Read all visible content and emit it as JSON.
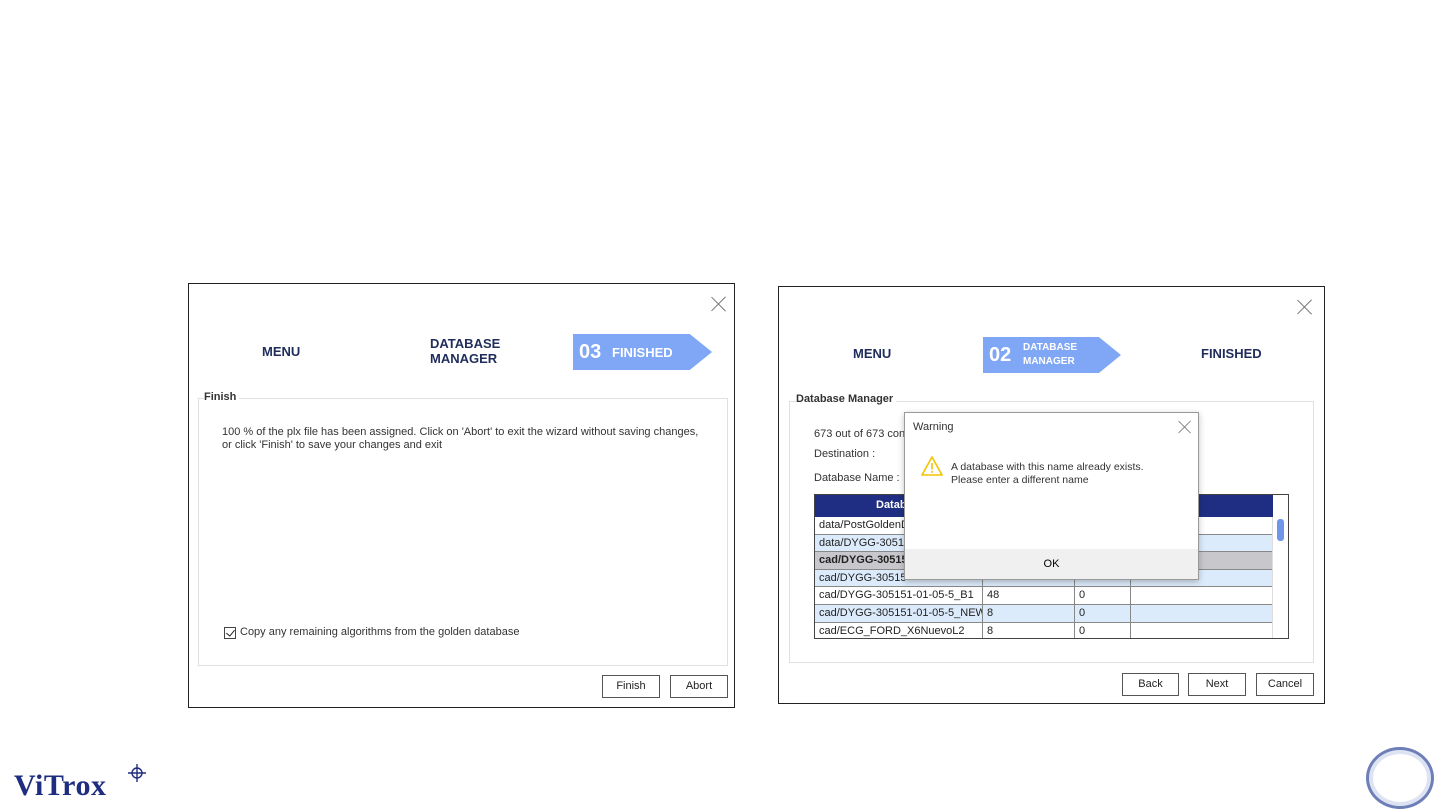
{
  "window1": {
    "steps": {
      "menu": "MENU",
      "database_manager_line1": "DATABASE",
      "database_manager_line2": "MANAGER",
      "active_number": "03",
      "active_label": "FINISHED"
    },
    "group_title": "Finish",
    "message_line1": "100 % of the plx file has been assigned. Click on 'Abort' to exit the wizard without saving changes,",
    "message_line2": "or click 'Finish' to save your changes and exit",
    "checkbox_label": "Copy any remaining algorithms from the golden database",
    "checkbox_checked": true,
    "finish_button": "Finish",
    "abort_button": "Abort"
  },
  "window2": {
    "steps": {
      "menu": "MENU",
      "active_number": "02",
      "active_label_line1": "DATABASE",
      "active_label_line2": "MANAGER",
      "finished": "FINISHED"
    },
    "group_title": "Database Manager",
    "count_text": "673 out of 673 con",
    "destination_label": "Destination :",
    "database_name_label": "Database Name :",
    "table": {
      "header": "Datab",
      "rows": [
        {
          "name": "data/PostGoldenD",
          "c2": "",
          "c3": "",
          "c4": "",
          "style": "normal"
        },
        {
          "name": "data/DYGG-30515",
          "c2": "",
          "c3": "",
          "c4": "",
          "style": "alt"
        },
        {
          "name": "cad/DYGG-30515",
          "c2": "",
          "c3": "",
          "c4": "",
          "style": "sel"
        },
        {
          "name": "cad/DYGG-30515",
          "c2": "",
          "c3": "",
          "c4": "",
          "style": "alt"
        },
        {
          "name": "cad/DYGG-305151-01-05-5_B1",
          "c2": "48",
          "c3": "0",
          "c4": "",
          "style": "normal"
        },
        {
          "name": "cad/DYGG-305151-01-05-5_NEW",
          "c2": "8",
          "c3": "0",
          "c4": "",
          "style": "alt"
        },
        {
          "name": "cad/ECG_FORD_X6NuevoL2",
          "c2": "8",
          "c3": "0",
          "c4": "",
          "style": "normal"
        }
      ]
    },
    "warning": {
      "title": "Warning",
      "message_line1": "A database with this name already exists.",
      "message_line2": "Please enter a different name",
      "ok_button": "OK"
    },
    "back_button": "Back",
    "next_button": "Next",
    "cancel_button": "Cancel"
  },
  "logo": {
    "text": "ViTrox"
  },
  "colors": {
    "accent_arrow": "#7fa7f5",
    "step_text": "#1f2d5c",
    "table_header": "#1f2e82",
    "row_alt": "#dcebfb",
    "row_selected": "#c8c8cc",
    "warning_icon": "#f2c300"
  }
}
